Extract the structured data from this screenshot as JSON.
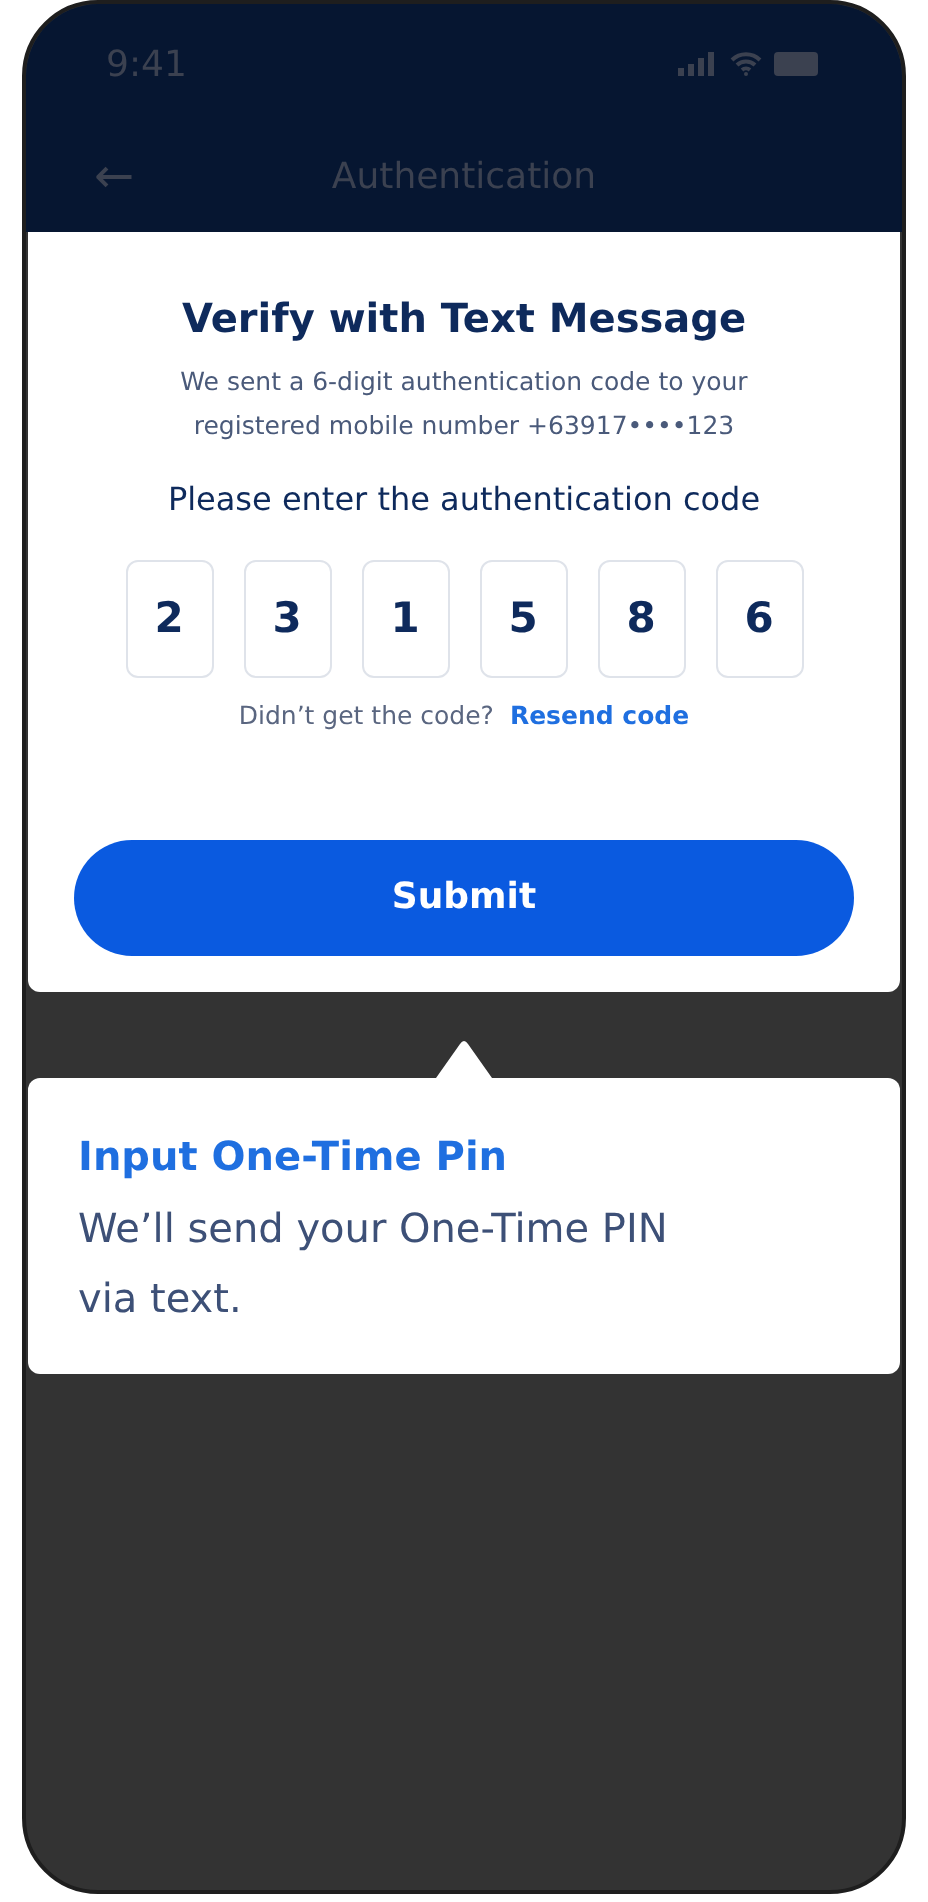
{
  "status_bar": {
    "time": "9:41"
  },
  "nav": {
    "title": "Authentication",
    "back": "←"
  },
  "card": {
    "title": "Verify with Text Message",
    "subtitle": "We sent a 6-digit authentication code to your registered mobile number +63917••••123",
    "prompt": "Please enter the authentication code",
    "code_digits": [
      "2",
      "3",
      "1",
      "5",
      "8",
      "6"
    ],
    "resend_prompt": "Didn’t get the code?",
    "resend_link": "Resend code",
    "submit": "Submit"
  },
  "tooltip": {
    "title": "Input One-Time Pin",
    "body": "We’ll send your One-Time PIN via text."
  }
}
